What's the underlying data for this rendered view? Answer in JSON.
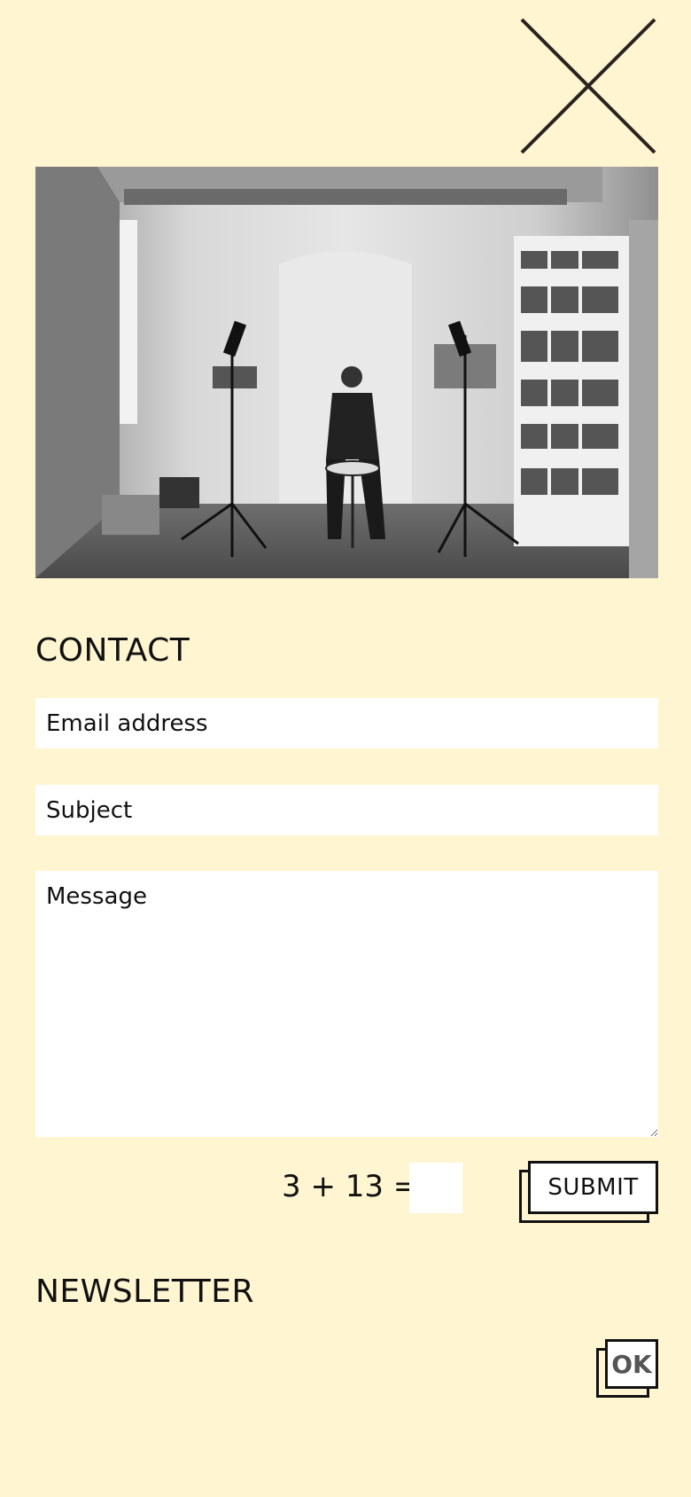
{
  "close": {
    "icon": "close-icon"
  },
  "photo": {
    "description_icon": "drummer-photo"
  },
  "contact": {
    "title": "CONTACT",
    "email_placeholder": "Email address",
    "subject_placeholder": "Subject",
    "message_placeholder": "Message",
    "captcha_question": "3 + 13 =",
    "captcha_value": "",
    "submit_label": "SUBMIT"
  },
  "newsletter": {
    "title": "NEWSLETTER",
    "ok_label": "OK"
  },
  "colors": {
    "background": "#fff5d1",
    "field": "#ffffff",
    "text": "#111111"
  }
}
